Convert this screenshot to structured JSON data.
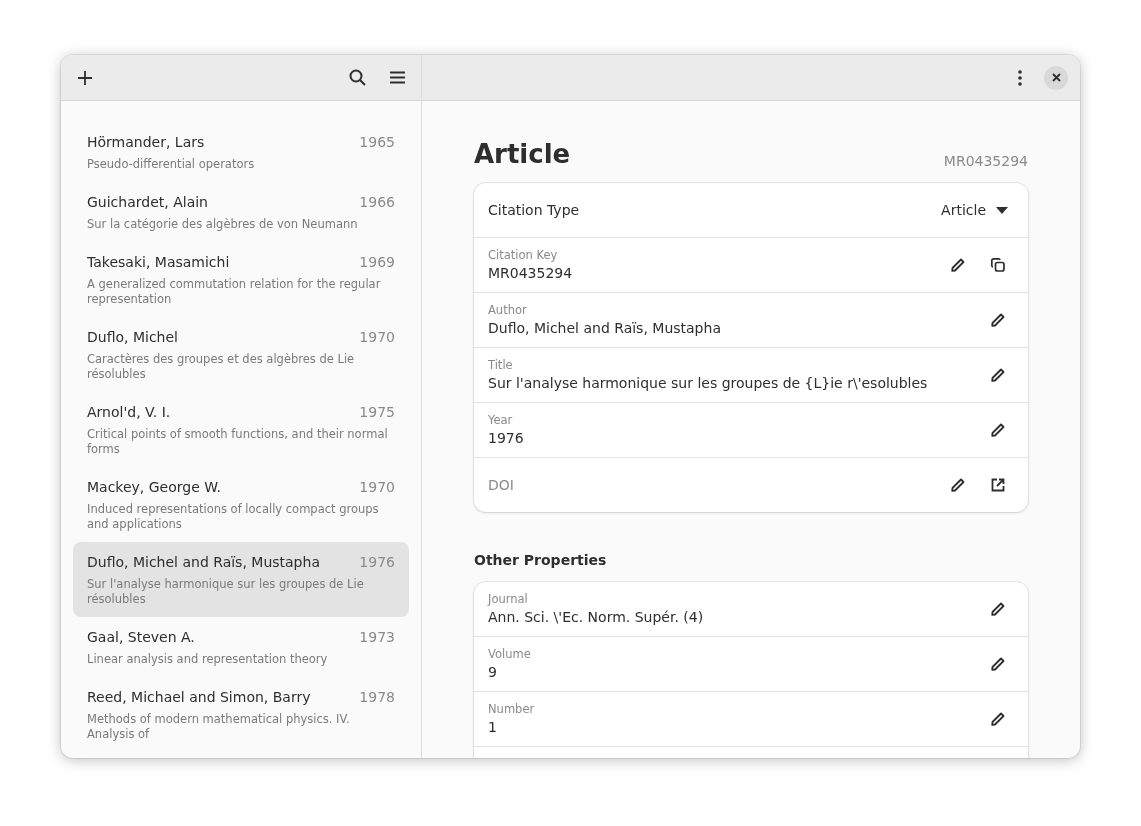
{
  "sidebar": {
    "items": [
      {
        "author": "Hörmander, Lars",
        "year": "1965",
        "title": "Pseudo-differential operators",
        "selected": false
      },
      {
        "author": "Guichardet, Alain",
        "year": "1966",
        "title": "Sur la catégorie des algèbres de von Neumann",
        "selected": false
      },
      {
        "author": "Takesaki, Masamichi",
        "year": "1969",
        "title": "A generalized commutation relation for the regular representation",
        "selected": false
      },
      {
        "author": "Duflo, Michel",
        "year": "1970",
        "title": "Caractères des groupes et des algèbres de Lie résolubles",
        "selected": false
      },
      {
        "author": "Arnol'd, V. I.",
        "year": "1975",
        "title": "Critical points of smooth functions, and their normal forms",
        "selected": false
      },
      {
        "author": "Mackey, George W.",
        "year": "1970",
        "title": "Induced representations of locally compact groups and applications",
        "selected": false
      },
      {
        "author": "Duflo, Michel and Raïs, Mustapha",
        "year": "1976",
        "title": "Sur l'analyse harmonique sur les groupes de Lie résolubles",
        "selected": true
      },
      {
        "author": "Gaal, Steven A.",
        "year": "1973",
        "title": "Linear analysis and representation theory",
        "selected": false
      },
      {
        "author": "Reed, Michael and Simon, Barry",
        "year": "1978",
        "title": "Methods of modern mathematical physics. IV. Analysis of",
        "selected": false
      }
    ]
  },
  "detail": {
    "heading": "Article",
    "key": "MR0435294",
    "main_rows": [
      {
        "kind": "select",
        "label": "Citation Type",
        "value": "Article"
      },
      {
        "kind": "key",
        "label": "Citation Key",
        "value": "MR0435294"
      },
      {
        "kind": "text",
        "label": "Author",
        "value": "Duflo, Michel and Raïs, Mustapha"
      },
      {
        "kind": "text",
        "label": "Title",
        "value": "Sur l'analyse harmonique sur les groupes de {L}ie r\\'esolubles"
      },
      {
        "kind": "text",
        "label": "Year",
        "value": "1976"
      },
      {
        "kind": "link",
        "label": "DOI"
      }
    ],
    "other_heading": "Other Properties",
    "other_rows": [
      {
        "kind": "text",
        "label": "Journal",
        "value": "Ann. Sci. \\'Ec. Norm. Supér. (4)"
      },
      {
        "kind": "text",
        "label": "Volume",
        "value": "9"
      },
      {
        "kind": "text",
        "label": "Number",
        "value": "1"
      }
    ]
  }
}
